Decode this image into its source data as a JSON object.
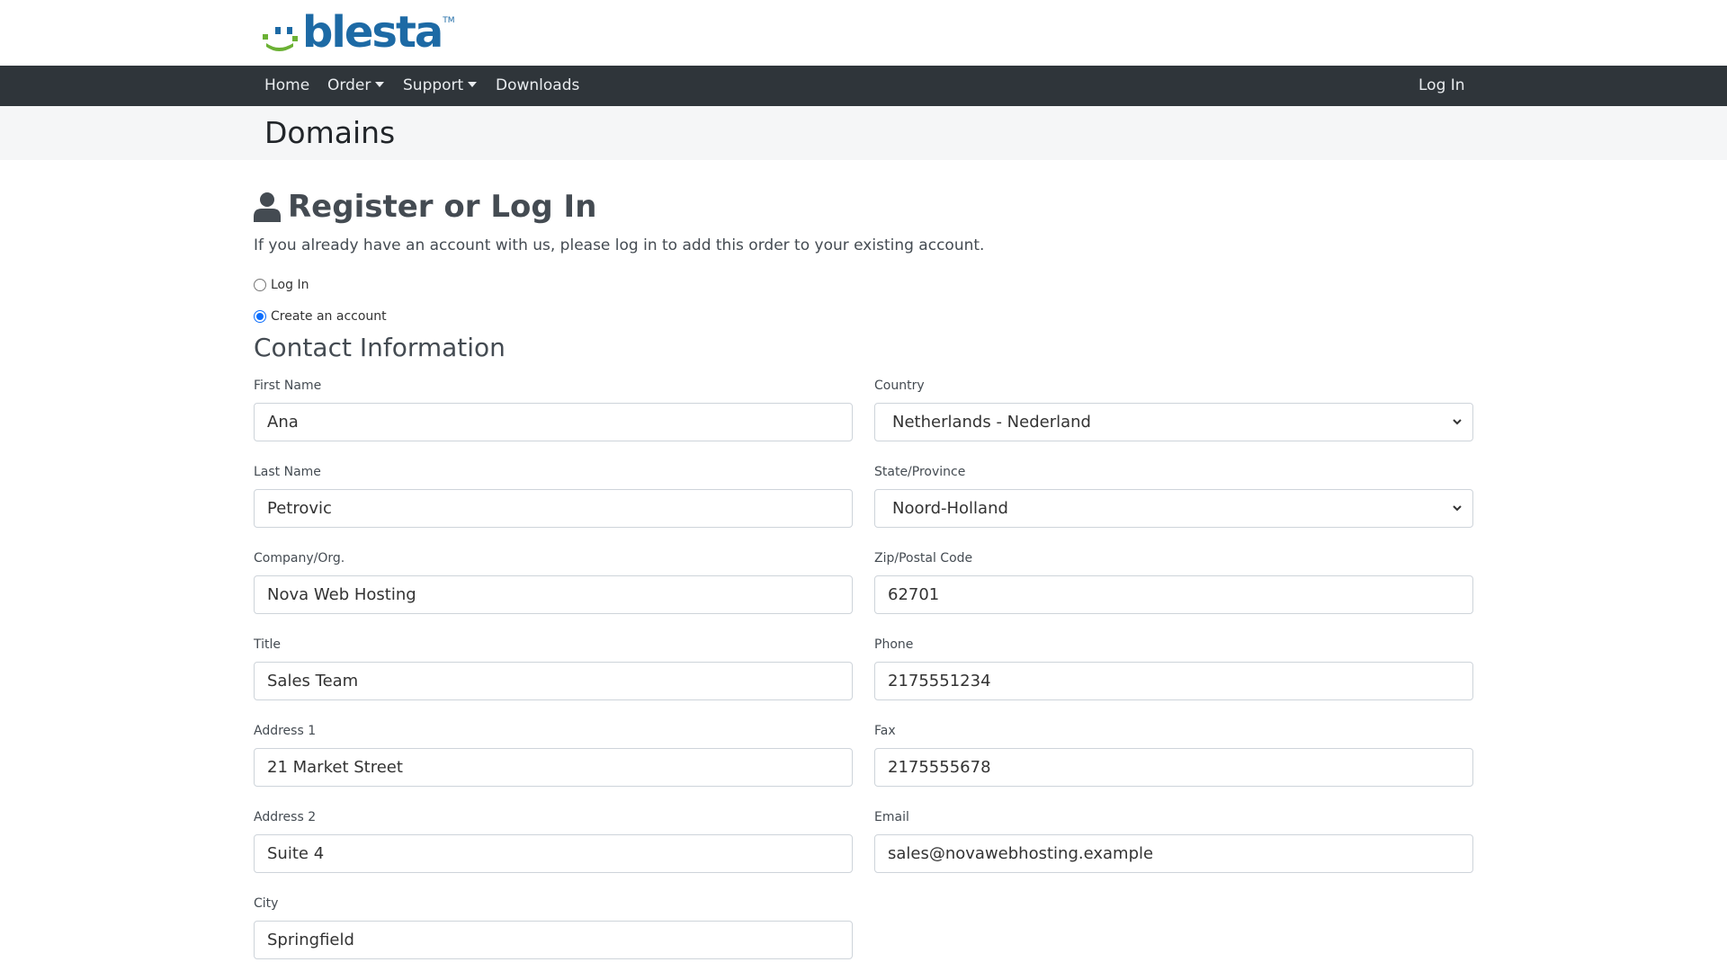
{
  "brand": {
    "logo_text": "blesta",
    "trademark": "TM"
  },
  "nav": {
    "home": "Home",
    "order": "Order",
    "support": "Support",
    "downloads": "Downloads",
    "login": "Log In"
  },
  "page_title": "Domains",
  "register": {
    "heading": "Register or Log In",
    "intro": "If you already have an account with us, please log in to add this order to your existing account.",
    "option_login": "Log In",
    "option_create": "Create an account",
    "selected_option": "Create an account"
  },
  "contact": {
    "heading": "Contact Information",
    "first_name": {
      "label": "First Name",
      "value": "Ana"
    },
    "last_name": {
      "label": "Last Name",
      "value": "Petrovic"
    },
    "company": {
      "label": "Company/Org.",
      "value": "Nova Web Hosting"
    },
    "title": {
      "label": "Title",
      "value": "Sales Team"
    },
    "address1": {
      "label": "Address 1",
      "value": "21 Market Street"
    },
    "address2": {
      "label": "Address 2",
      "value": "Suite 4"
    },
    "city": {
      "label": "City",
      "value": "Springfield"
    },
    "country": {
      "label": "Country",
      "value": "Netherlands - Nederland"
    },
    "state": {
      "label": "State/Province",
      "value": "Noord-Holland"
    },
    "zip": {
      "label": "Zip/Postal Code",
      "value": "62701"
    },
    "phone": {
      "label": "Phone",
      "value": "2175551234"
    },
    "fax": {
      "label": "Fax",
      "value": "2175555678"
    },
    "email": {
      "label": "Email",
      "value": "sales@novawebhosting.example"
    }
  },
  "colors": {
    "navbar_bg": "#2f353a",
    "logo_blue": "#1d6aa5",
    "logo_green": "#6bb134",
    "title_band_bg": "#f5f6f7",
    "radio_accent": "#0d6efd"
  },
  "icons": [
    "blesta-logo-icon",
    "user-icon",
    "chevron-down-icon"
  ]
}
